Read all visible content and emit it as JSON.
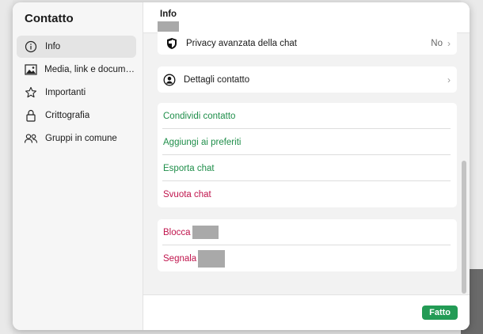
{
  "sidebar": {
    "title": "Contatto",
    "items": [
      {
        "label": "Info",
        "icon": "info-icon"
      },
      {
        "label": "Media, link e documenti",
        "icon": "image-icon"
      },
      {
        "label": "Importanti",
        "icon": "star-icon"
      },
      {
        "label": "Crittografia",
        "icon": "lock-icon"
      },
      {
        "label": "Gruppi in comune",
        "icon": "group-icon"
      }
    ]
  },
  "header": {
    "title": "Info"
  },
  "privacy": {
    "label": "Privacy avanzata della chat",
    "value": "No",
    "icon": "shield-icon"
  },
  "contact_details": {
    "label": "Dettagli contatto",
    "icon": "user-circle-icon"
  },
  "actions": {
    "share": "Condividi contatto",
    "favorite": "Aggiungi ai preferiti",
    "export": "Esporta chat",
    "clear": "Svuota chat"
  },
  "danger": {
    "block": "Blocca",
    "report": "Segnala"
  },
  "footer": {
    "done_label": "Fatto"
  },
  "colors": {
    "accent": "#239b55",
    "green_text": "#1f8e4a",
    "red_text": "#c0154d"
  }
}
